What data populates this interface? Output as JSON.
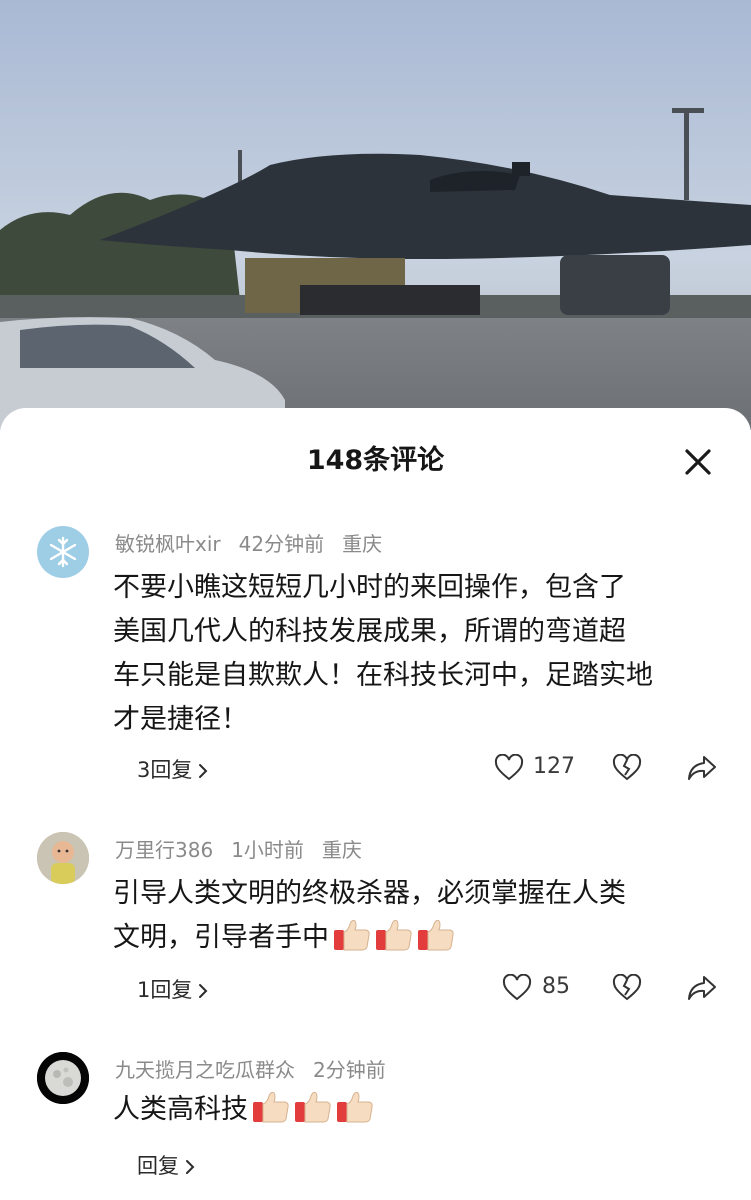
{
  "sheet": {
    "title": "148条评论"
  },
  "comments": [
    {
      "user": "敏锐枫叶xir",
      "time": "42分钟前",
      "location": "重庆",
      "text_lines": [
        "不要小瞧这短短几小时的来回操作，包含了",
        "美国几代人的科技发展成果，所谓的弯道超",
        "车只能是自欺欺人！在科技长河中，足踏实地",
        "才是捷径！"
      ],
      "reply_label": "3回复",
      "likes": "127",
      "avatar_icon": "snowflake-icon"
    },
    {
      "user": "万里行386",
      "time": "1小时前",
      "location": "重庆",
      "text_lines": [
        "引导人类文明的终极杀器，必须掌握在人类",
        "文明，引导者手中"
      ],
      "reply_label": "1回复",
      "likes": "85",
      "avatar_icon": "baby-photo"
    },
    {
      "user": "九天揽月之吃瓜群众",
      "time": "2分钟前",
      "text_lines": [
        "人类高科技"
      ],
      "reply_label": "回复",
      "avatar_icon": "moon-photo"
    }
  ],
  "icons": {
    "close": "close-icon",
    "like": "heart-icon",
    "dislike": "broken-heart-icon",
    "share": "share-arrow-icon",
    "emoji": "thumbs-up-emoji"
  },
  "colors": {
    "sheet_bg": "#ffffff",
    "text": "#161616",
    "meta": "#8a8a8a"
  }
}
